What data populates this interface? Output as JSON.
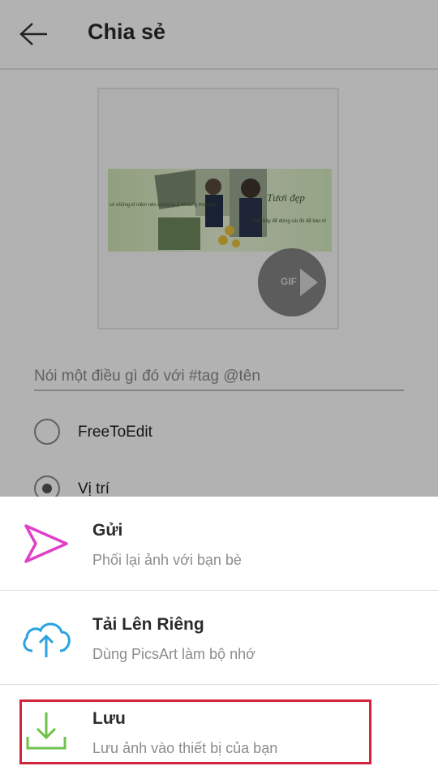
{
  "header": {
    "title": "Chia sẻ"
  },
  "preview": {
    "gif_badge": "GIF",
    "image_text": {
      "left_caption": "có những kỉ niệm nên dừng lại ở khoảng thời gian",
      "script_word": "Tươi đẹp",
      "right_caption": "nhất, hãy để dừng cái đó để bảo trì"
    }
  },
  "caption": {
    "placeholder": "Nói một điều gì đó với #tag @tên"
  },
  "options": [
    {
      "label": "FreeToEdit",
      "checked": false
    },
    {
      "label": "Vị trí",
      "checked": true
    }
  ],
  "sheet": {
    "items": [
      {
        "title": "Gửi",
        "subtitle": "Phối lại ảnh với bạn bè",
        "icon": "send-icon",
        "color": "#e040c8"
      },
      {
        "title": "Tải Lên Riêng",
        "subtitle": "Dùng PicsArt làm bộ nhớ",
        "icon": "cloud-upload-icon",
        "color": "#2aa3e0"
      },
      {
        "title": "Lưu",
        "subtitle": "Lưu ảnh vào thiết bị của bạn",
        "icon": "download-icon",
        "color": "#6cc24a"
      }
    ]
  },
  "colors": {
    "highlight": "#d1263e",
    "dim_overlay": "rgba(0,0,0,0.30)"
  }
}
